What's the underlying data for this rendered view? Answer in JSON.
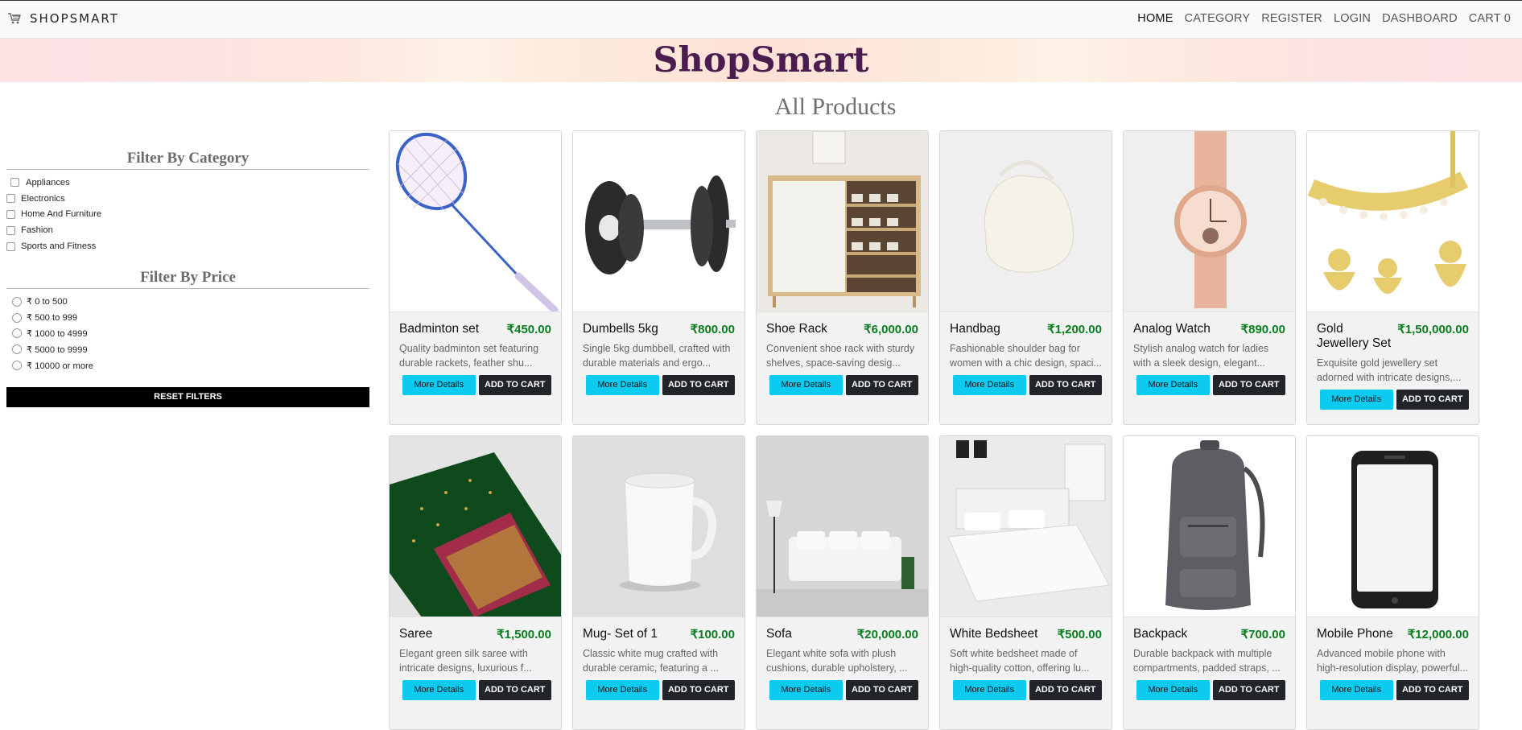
{
  "nav": {
    "brand": "SHOPSMART",
    "links": [
      "HOME",
      "CATEGORY",
      "REGISTER",
      "LOGIN",
      "DASHBOARD",
      "CART 0"
    ]
  },
  "hero": {
    "title": "ShopSmart"
  },
  "page_title": "All Products",
  "filters": {
    "category_heading": "Filter By Category",
    "categories": [
      "Appliances",
      "Electronics",
      "Home And Furniture",
      "Fashion",
      "Sports and Fitness"
    ],
    "price_heading": "Filter By Price",
    "prices": [
      "₹ 0 to 500",
      "₹ 500 to 999",
      "₹ 1000 to 4999",
      "₹ 5000 to 9999",
      "₹ 10000 or more"
    ],
    "reset_label": "RESET FILTERS"
  },
  "buttons": {
    "details": "More Details",
    "cart": "ADD TO CART"
  },
  "products": [
    {
      "name": "Badminton set",
      "price": "₹450.00",
      "desc": "Quality badminton set featuring durable rackets, feather shu...",
      "icon": "badminton-racket"
    },
    {
      "name": "Dumbells 5kg",
      "price": "₹800.00",
      "desc": "Single 5kg dumbbell, crafted with durable materials and ergo...",
      "icon": "dumbbell"
    },
    {
      "name": "Shoe Rack",
      "price": "₹6,000.00",
      "desc": "Convenient shoe rack with sturdy shelves, space-saving desig...",
      "icon": "shoe-rack"
    },
    {
      "name": "Handbag",
      "price": "₹1,200.00",
      "desc": "Fashionable shoulder bag for women with a chic design, spaci...",
      "icon": "handbag"
    },
    {
      "name": "Analog Watch",
      "price": "₹890.00",
      "desc": "Stylish analog watch for ladies with a sleek design, elegant...",
      "icon": "watch"
    },
    {
      "name": "Gold Jewellery Set",
      "price": "₹1,50,000.00",
      "desc": "Exquisite gold jewellery set adorned with intricate designs,...",
      "icon": "jewellery"
    },
    {
      "name": "Saree",
      "price": "₹1,500.00",
      "desc": "Elegant green silk saree with intricate designs, luxurious f...",
      "icon": "saree"
    },
    {
      "name": "Mug- Set of 1",
      "price": "₹100.00",
      "desc": "Classic white mug crafted with durable ceramic, featuring a ...",
      "icon": "mug"
    },
    {
      "name": "Sofa",
      "price": "₹20,000.00",
      "desc": "Elegant white sofa with plush cushions, durable upholstery, ...",
      "icon": "sofa"
    },
    {
      "name": "White Bedsheet",
      "price": "₹500.00",
      "desc": "Soft white bedsheet made of high-quality cotton, offering lu...",
      "icon": "bed"
    },
    {
      "name": "Backpack",
      "price": "₹700.00",
      "desc": "Durable backpack with multiple compartments, padded straps, ...",
      "icon": "backpack"
    },
    {
      "name": "Mobile Phone",
      "price": "₹12,000.00",
      "desc": "Advanced mobile phone with high-resolution display, powerful...",
      "icon": "phone"
    }
  ]
}
